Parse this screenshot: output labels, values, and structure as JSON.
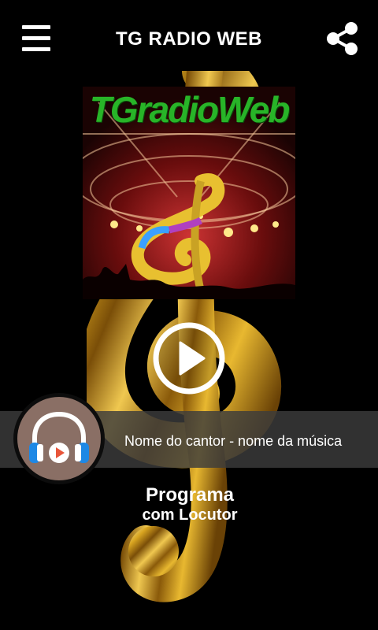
{
  "header": {
    "title": "TG RADIO WEB",
    "menu_icon": "hamburger-menu-icon",
    "share_icon": "share-icon"
  },
  "cover": {
    "text": "TGradioWeb"
  },
  "player": {
    "play_icon": "play-icon",
    "now_playing": "Nome do cantor - nome da música",
    "station_logo_icon": "headphones-icon"
  },
  "program": {
    "name": "Programa",
    "host": "com Locutor"
  },
  "colors": {
    "background": "#000000",
    "text": "#ffffff",
    "gold": "#d9a520",
    "now_bar": "#3c3c3c",
    "logo_circle": "#8a6f65",
    "headphone_blue": "#1e88e5",
    "play_red": "#e8553a"
  }
}
